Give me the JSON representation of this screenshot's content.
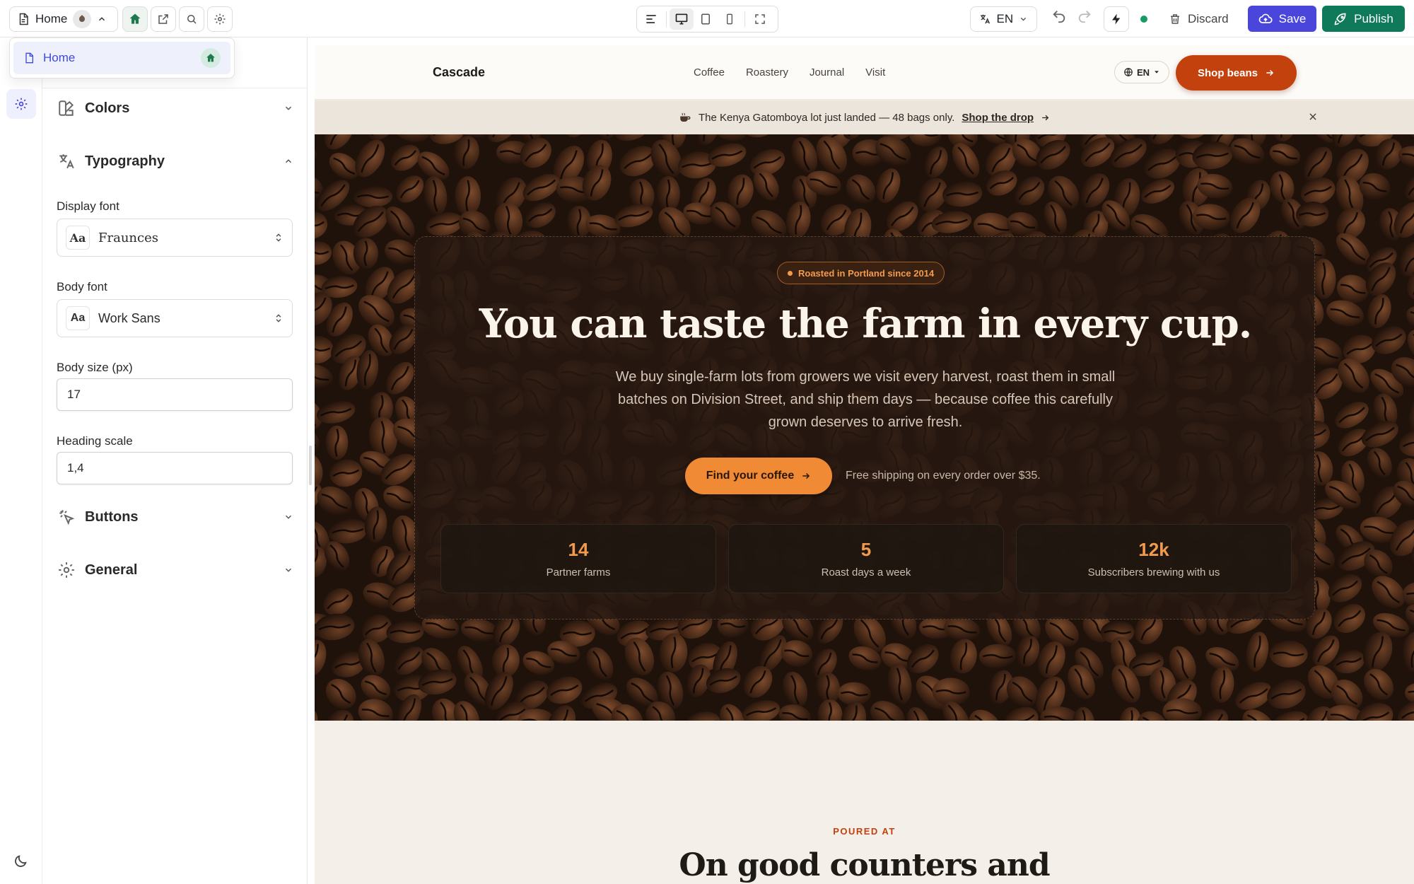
{
  "toolbar": {
    "page_name": "Home",
    "lang": "EN",
    "discard_label": "Discard",
    "save_label": "Save",
    "publish_label": "Publish"
  },
  "page_dropdown": {
    "items": [
      {
        "label": "Home"
      }
    ]
  },
  "panel": {
    "sections": {
      "colors": "Colors",
      "typography": "Typography",
      "buttons": "Buttons",
      "general": "General"
    },
    "display_font": {
      "label": "Display font",
      "value": "Fraunces",
      "prefix": "Aa"
    },
    "body_font": {
      "label": "Body font",
      "value": "Work Sans",
      "prefix": "Aa"
    },
    "body_size": {
      "label": "Body size (px)",
      "value": "17"
    },
    "heading_scale": {
      "label": "Heading scale",
      "value": "1,4"
    }
  },
  "site": {
    "brand": "Cascade",
    "nav": [
      "Coffee",
      "Roastery",
      "Journal",
      "Visit"
    ],
    "lang": "EN",
    "shop_button": "Shop beans",
    "announcement": {
      "text": "The Kenya Gatomboya lot just landed — 48 bags only.",
      "link": "Shop the drop"
    },
    "hero": {
      "badge": "Roasted in Portland since 2014",
      "title": "You can taste the farm in every cup.",
      "subtitle": "We buy single-farm lots from growers we visit every harvest, roast them in small batches on Division Street, and ship them days — because coffee this carefully grown deserves to arrive fresh.",
      "cta": "Find your coffee",
      "note": "Free shipping on every order over $35.",
      "stats": [
        {
          "value": "14",
          "label": "Partner farms"
        },
        {
          "value": "5",
          "label": "Roast days a week"
        },
        {
          "value": "12k",
          "label": "Subscribers brewing with us"
        }
      ]
    },
    "next_section": {
      "eyebrow": "POURED AT",
      "title": "On good counters and"
    }
  },
  "colors": {
    "save": "#4a46dc",
    "publish": "#0e7a5a",
    "accent": "#c2410c",
    "hero_accent": "#f08a35"
  }
}
